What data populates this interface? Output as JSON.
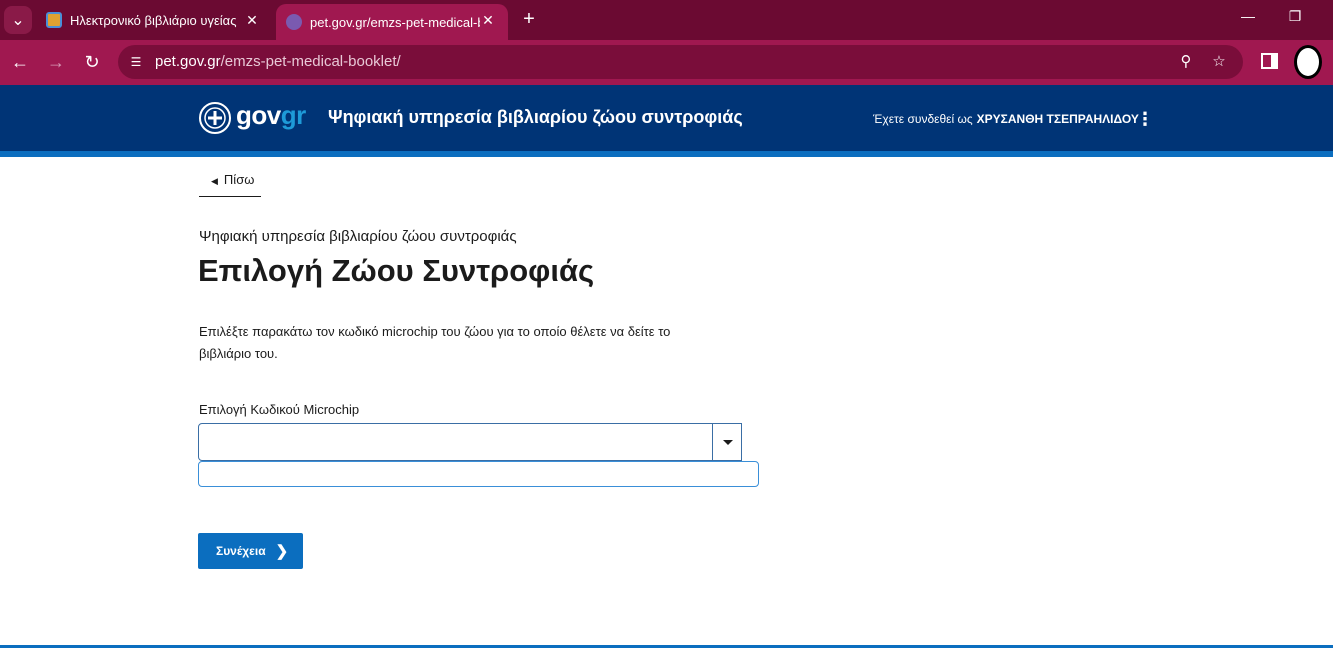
{
  "browser": {
    "tabs": [
      {
        "title": "Ηλεκτρονικό βιβλιάριο υγείας ζ",
        "active": false
      },
      {
        "title": "pet.gov.gr/emzs-pet-medical-b",
        "active": true
      }
    ],
    "url_host": "pet.gov.gr",
    "url_path": "/emzs-pet-medical-booklet/",
    "icons": {
      "tab_menu": "chevron-down-icon",
      "new_tab": "plus-icon",
      "back": "arrow-left-icon",
      "forward": "arrow-right-icon",
      "reload": "reload-icon",
      "site_info": "tune-icon",
      "zoom": "zoom-icon",
      "bookmark": "star-icon",
      "side_panel": "side-panel-icon",
      "minimize": "minimize-icon",
      "restore": "restore-icon"
    }
  },
  "header": {
    "logo_gov": "gov",
    "logo_gr": "gr",
    "service_title": "Ψηφιακή υπηρεσία βιβλιαρίου ζώου συντροφιάς",
    "user_prefix": "Έχετε συνδεθεί ως",
    "user_name": "ΧΡΥΣΑΝΘΗ ΤΣΕΠΡΑΗΛΙΔΟΥ"
  },
  "main": {
    "back_label": "Πίσω",
    "caption": "Ψηφιακή υπηρεσία βιβλιαρίου ζώου συντροφιάς",
    "heading": "Επιλογή Ζώου Συντροφιάς",
    "description": "Επιλέξτε παρακάτω τον κωδικό microchip του ζώου για το οποίο θέλετε να δείτε το βιβλιάριο του.",
    "field_label": "Επιλογή Κωδικού Microchip",
    "select_value": "",
    "continue_label": "Συνέχεια"
  },
  "colors": {
    "tabstrip": "#6b0a32",
    "toolbar": "#a01850",
    "gov_header": "#003476",
    "accent": "#0b6ebf"
  }
}
